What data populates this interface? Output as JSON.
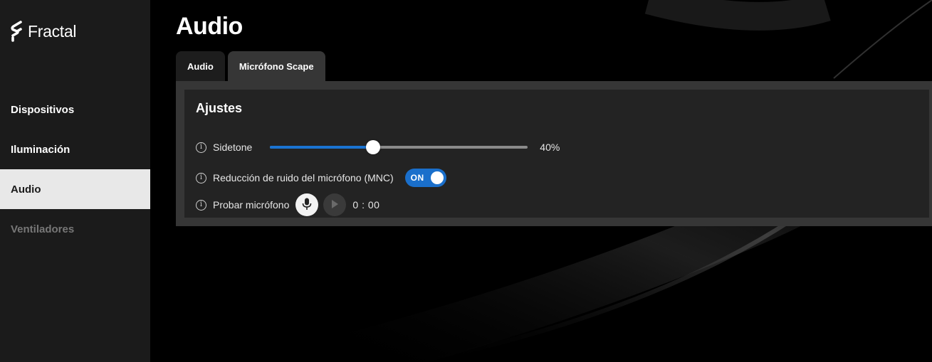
{
  "app": {
    "logo_text": "Fractal"
  },
  "sidebar": {
    "items": [
      {
        "label": "Dispositivos",
        "state": "normal"
      },
      {
        "label": "Iluminación",
        "state": "normal"
      },
      {
        "label": "Audio",
        "state": "active"
      },
      {
        "label": "Ventiladores",
        "state": "disabled"
      }
    ]
  },
  "main": {
    "title": "Audio",
    "tabs": [
      {
        "label": "Audio",
        "active": false
      },
      {
        "label": "Micrófono Scape",
        "active": true
      }
    ],
    "panel": {
      "title": "Ajustes",
      "sidetone": {
        "label": "Sidetone",
        "value_percent": 40,
        "value_text": "40%"
      },
      "mnc": {
        "label": "Reducción de ruido del micrófono (MNC)",
        "toggle_text": "ON",
        "on": true
      },
      "test_mic": {
        "label": "Probar micrófono",
        "timer": "0 : 00"
      }
    }
  },
  "colors": {
    "accent": "#1a73d1",
    "sidebar_bg": "#1b1b1b",
    "active_nav_bg": "#e8e8e8"
  },
  "icons": [
    "fractal-logo-icon",
    "info-icon",
    "microphone-icon",
    "play-icon"
  ]
}
